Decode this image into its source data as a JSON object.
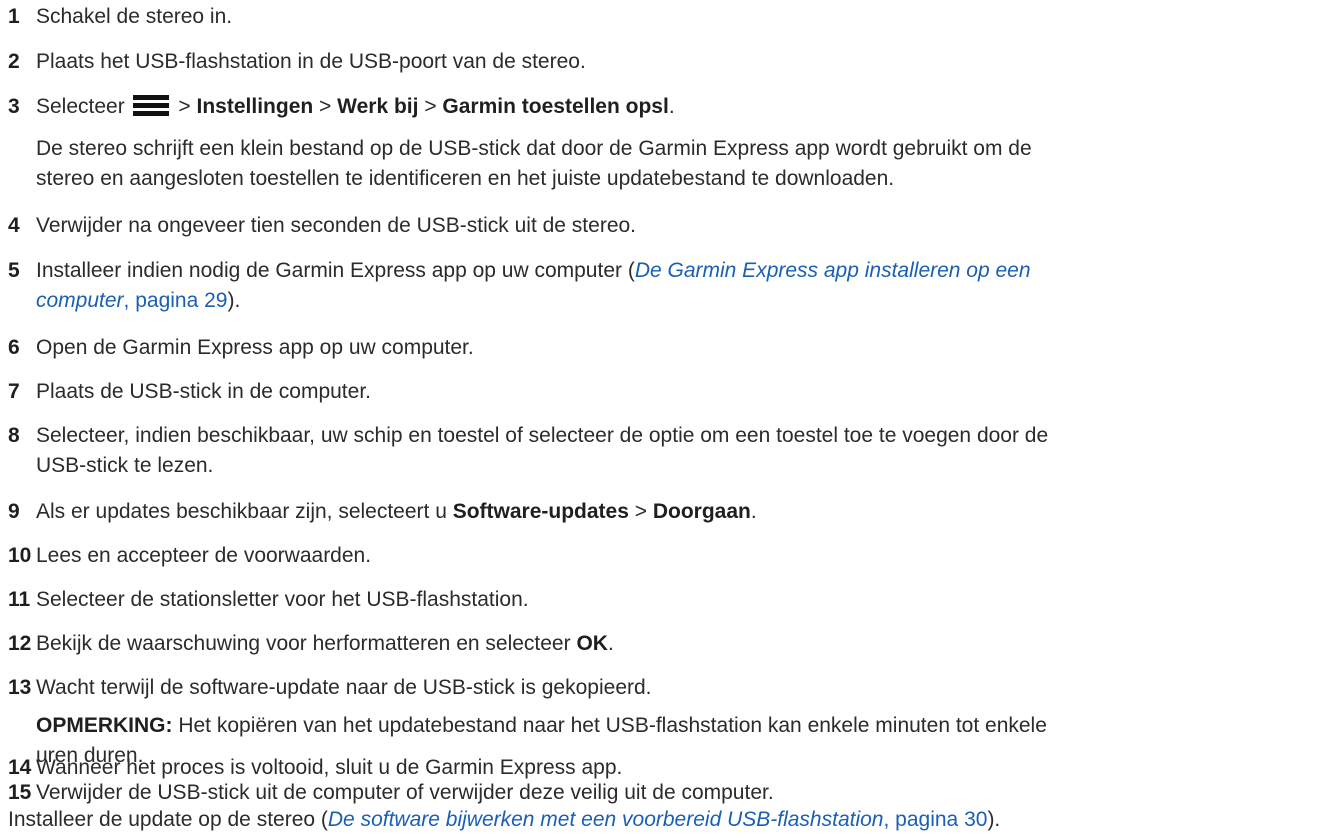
{
  "steps": [
    {
      "num": "1",
      "text": "Schakel de stereo in."
    },
    {
      "num": "2",
      "text": "Plaats het USB-flashstation in de USB-poort van de stereo."
    },
    {
      "num": "3",
      "pre": "Selecteer",
      "sep1": ">",
      "b1": "Instellingen",
      "sep2": ">",
      "b2": "Werk bij",
      "sep3": ">",
      "b3": "Garmin toestellen opsl",
      "end": ".",
      "note_line1": "De stereo schrijft een klein bestand op de USB-stick dat door de Garmin Express app wordt gebruikt om de",
      "note_line2": "stereo en aangesloten toestellen te identificeren en het juiste updatebestand te downloaden."
    },
    {
      "num": "4",
      "text": "Verwijder na ongeveer tien seconden de USB-stick uit de stereo."
    },
    {
      "num": "5",
      "pre": "Installeer indien nodig de Garmin Express app op uw computer (",
      "link_line1": "De Garmin Express app installeren op een",
      "link_line2": "computer",
      "link_page": ", pagina 29",
      "post": ")."
    },
    {
      "num": "6",
      "text": "Open de Garmin Express app op uw computer."
    },
    {
      "num": "7",
      "text": "Plaats de USB-stick in de computer."
    },
    {
      "num": "8",
      "line1": "Selecteer, indien beschikbaar, uw schip en toestel of selecteer de optie om een toestel toe te voegen door de",
      "line2": "USB-stick te lezen."
    },
    {
      "num": "9",
      "pre": "Als er updates beschikbaar zijn, selecteert u ",
      "b1": "Software-updates",
      "sep": " > ",
      "b2": "Doorgaan",
      "end": "."
    },
    {
      "num": "10",
      "text": "Lees en accepteer de voorwaarden."
    },
    {
      "num": "11",
      "text": "Selecteer de stationsletter voor het USB-flashstation."
    },
    {
      "num": "12",
      "pre": "Bekijk de waarschuwing voor herformatteren en selecteer ",
      "b1": "OK",
      "end": "."
    },
    {
      "num": "13",
      "text": "Wacht terwijl de software-update naar de USB-stick is gekopieerd.",
      "note_label": "OPMERKING:",
      "note_line1": " Het kopiëren van het updatebestand naar het USB-flashstation kan enkele minuten tot enkele",
      "note_line2": "uren duren."
    },
    {
      "num": "14",
      "text": "Wanneer het proces is voltooid, sluit u de Garmin Express app."
    },
    {
      "num": "15",
      "text": "Verwijder de USB-stick uit de computer of verwijder deze veilig uit de computer."
    }
  ],
  "final": {
    "pre": "Installeer de update op de stereo (",
    "link": "De software bijwerken met een voorbereid USB-flashstation",
    "link_page": ", pagina 30",
    "post": ")."
  },
  "icons": {
    "menu": "menu-icon"
  }
}
